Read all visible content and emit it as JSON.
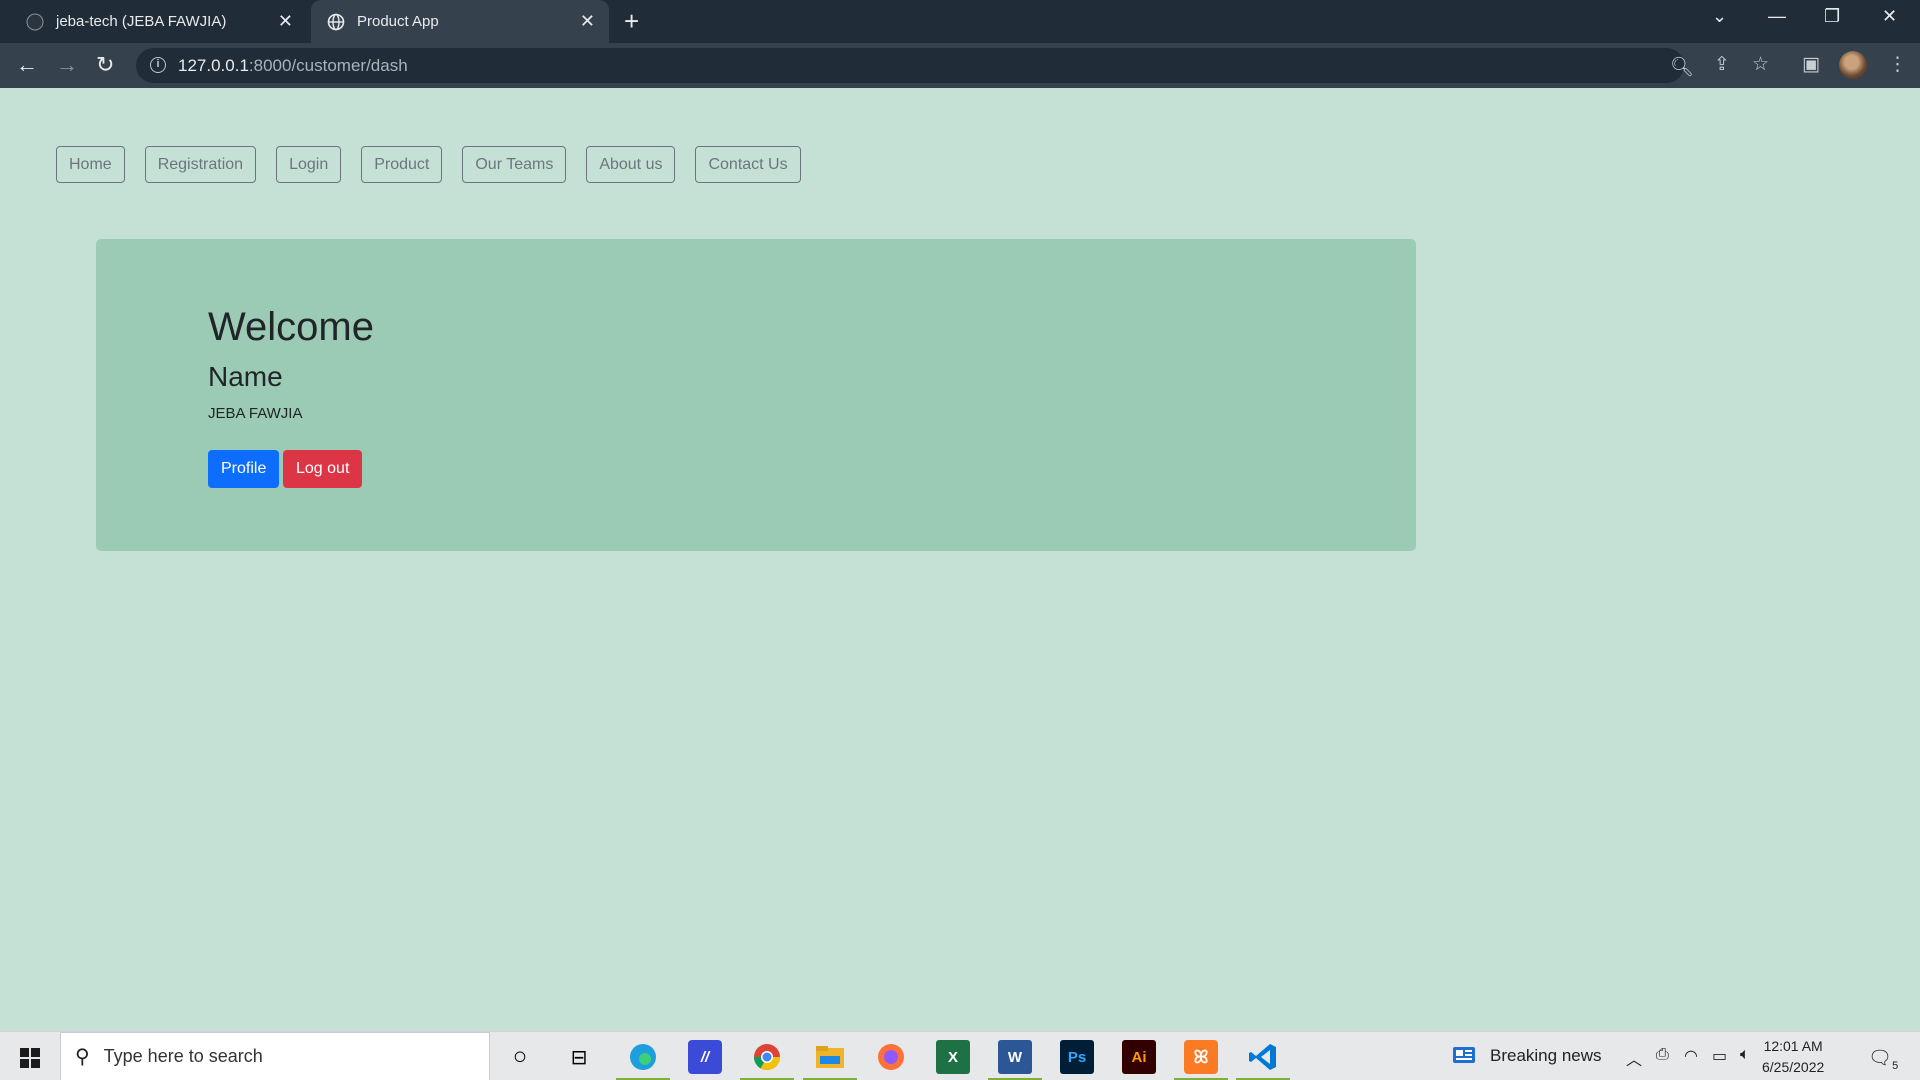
{
  "browser": {
    "tabs": [
      {
        "title": "jeba-tech (JEBA FAWJIA)",
        "icon": "github-icon",
        "active": false
      },
      {
        "title": "Product App",
        "icon": "globe-icon",
        "active": true
      }
    ],
    "url_host": "127.0.0.1",
    "url_path": ":8000/customer/dash"
  },
  "nav": {
    "items": [
      "Home",
      "Registration",
      "Login",
      "Product",
      "Our Teams",
      "About us",
      "Contact Us"
    ]
  },
  "hero": {
    "title": "Welcome",
    "subtitle": "Name",
    "name_value": "JEBA FAWJIA",
    "profile_label": "Profile",
    "logout_label": "Log out"
  },
  "taskbar": {
    "search_placeholder": "Type here to search",
    "news_label": "Breaking news",
    "time": "12:01 AM",
    "date": "6/25/2022",
    "notification_count": "5"
  },
  "colors": {
    "page_bg": "#c5e1d6",
    "hero_bg": "#9bcbb4",
    "primary": "#0d6efd",
    "danger": "#dc3545",
    "nav_border": "#6c757d"
  }
}
